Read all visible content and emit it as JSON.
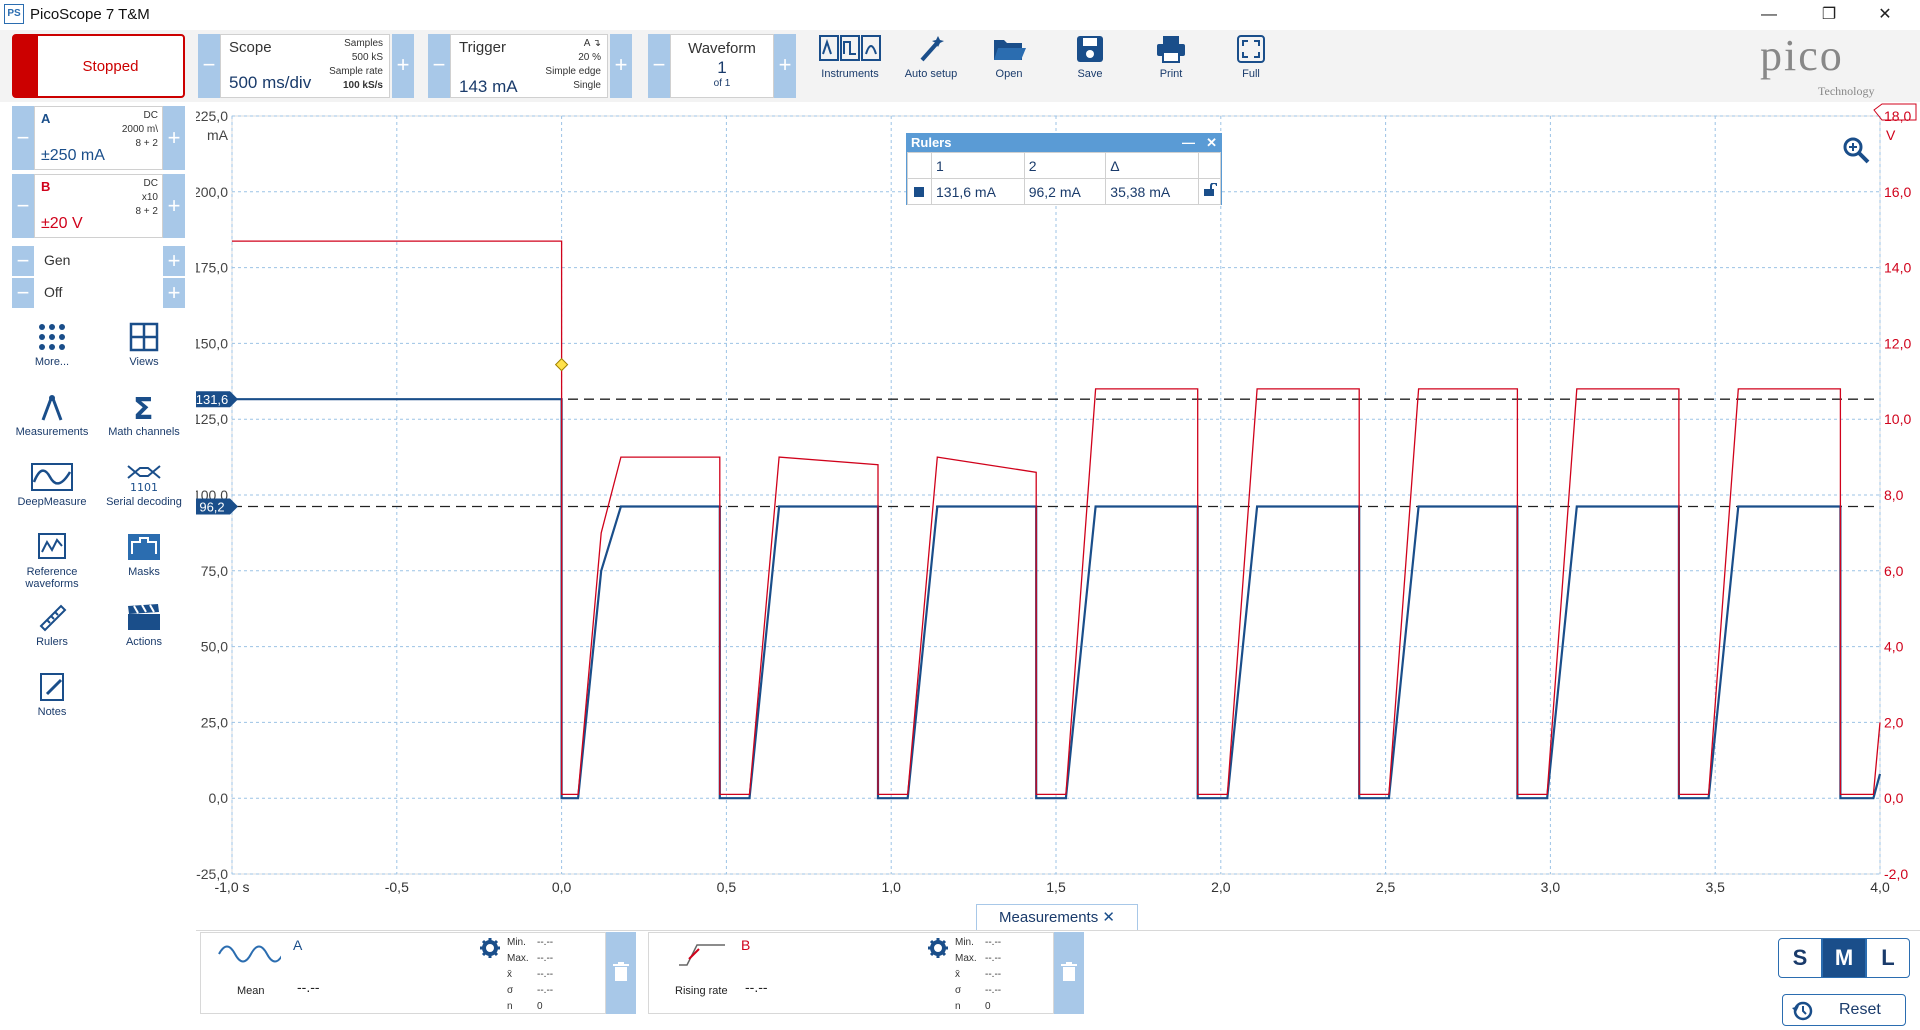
{
  "app": {
    "title": "PicoScope 7 T&M",
    "logo": "PS"
  },
  "window": {
    "minimize": "—",
    "maximize": "❐",
    "close": "✕"
  },
  "toolbar": {
    "run_state": "Stopped",
    "scope": {
      "label": "Scope",
      "value": "500 ms/div",
      "samples_label": "Samples",
      "samples": "500 kS",
      "rate_label": "Sample rate",
      "rate": "100 kS/s"
    },
    "trigger": {
      "label": "Trigger",
      "value": "143 mA",
      "channel": "A",
      "pct": "20 %",
      "type": "Simple edge",
      "mode": "Single"
    },
    "waveform": {
      "label": "Waveform",
      "value": "1",
      "of": "of 1"
    },
    "tools": [
      {
        "label": "Instruments"
      },
      {
        "label": "Auto setup"
      },
      {
        "label": "Open"
      },
      {
        "label": "Save"
      },
      {
        "label": "Print"
      },
      {
        "label": "Full"
      }
    ],
    "brand": "pico",
    "brand_sub": "Technology"
  },
  "channels": [
    {
      "name": "A",
      "range": "±250 mA",
      "coupling": "DC",
      "probe": "2000 m\\",
      "bits": "8 + 2",
      "color": "#1a4e8a"
    },
    {
      "name": "B",
      "range": "±20 V",
      "coupling": "DC",
      "probe": "x10",
      "bits": "8 + 2",
      "color": "#d0021b"
    }
  ],
  "gen": {
    "label": "Gen",
    "state": "Off"
  },
  "side_tools": [
    {
      "label": "More..."
    },
    {
      "label": "Views"
    },
    {
      "label": "Measurements"
    },
    {
      "label": "Math channels"
    },
    {
      "label": "DeepMeasure"
    },
    {
      "label": "Serial decoding"
    },
    {
      "label": "Reference waveforms"
    },
    {
      "label": "Masks"
    },
    {
      "label": "Rulers"
    },
    {
      "label": "Actions"
    },
    {
      "label": "Notes"
    }
  ],
  "plot": {
    "left_unit": "mA",
    "right_unit": "V",
    "left_ticks": [
      "225,0",
      "200,0",
      "175,0",
      "150,0",
      "125,0",
      "100,0",
      "75,0",
      "50,0",
      "25,0",
      "0,0",
      "-25,0"
    ],
    "right_ticks": [
      "18,0",
      "16,0",
      "14,0",
      "12,0",
      "10,0",
      "8,0",
      "6,0",
      "4,0",
      "2,0",
      "0,0",
      "-2,0"
    ],
    "x_ticks": [
      "-1,0 s",
      "-0,5",
      "0,0",
      "0,5",
      "1,0",
      "1,5",
      "2,0",
      "2,5",
      "3,0",
      "3,5",
      "4,0"
    ],
    "ruler1": "131,6",
    "ruler2": "96,2"
  },
  "chart_data": {
    "type": "line",
    "xlabel": "s",
    "ylabel": "mA",
    "xlim": [
      -1.0,
      4.0
    ],
    "ylim": [
      -25,
      225
    ],
    "y2lim": [
      -2,
      18
    ],
    "series": [
      {
        "name": "A",
        "color": "#1a4e8a",
        "axis": "left",
        "x": [
          -1.0,
          0.0,
          0.0,
          0.05,
          0.12,
          0.18,
          0.48,
          0.48,
          0.57,
          0.66,
          0.96,
          0.96,
          1.05,
          1.14,
          1.44,
          1.44,
          1.53,
          1.62,
          1.93,
          1.93,
          2.02,
          2.11,
          2.42,
          2.42,
          2.51,
          2.6,
          2.9,
          2.9,
          2.99,
          3.08,
          3.39,
          3.39,
          3.48,
          3.57,
          3.88,
          3.88,
          3.98,
          4.0
        ],
        "values": [
          131.6,
          131.6,
          0,
          0,
          75,
          96.2,
          96.2,
          0,
          0,
          96.2,
          96.2,
          0,
          0,
          96.2,
          96.2,
          0,
          0,
          96.2,
          96.2,
          0,
          0,
          96.2,
          96.2,
          0,
          0,
          96.2,
          96.2,
          0,
          0,
          96.2,
          96.2,
          0,
          0,
          96.2,
          96.2,
          0,
          0,
          8
        ]
      },
      {
        "name": "B",
        "color": "#d0021b",
        "axis": "right",
        "x": [
          -1.0,
          0.0,
          0.0,
          0.05,
          0.12,
          0.18,
          0.48,
          0.48,
          0.57,
          0.66,
          0.96,
          0.96,
          1.05,
          1.14,
          1.44,
          1.44,
          1.53,
          1.62,
          1.93,
          1.93,
          2.02,
          2.11,
          2.42,
          2.42,
          2.51,
          2.6,
          2.9,
          2.9,
          2.99,
          3.08,
          3.39,
          3.39,
          3.48,
          3.57,
          3.88,
          3.88,
          3.98,
          4.0
        ],
        "values": [
          14.7,
          14.7,
          0.1,
          0.1,
          7,
          9.0,
          9.0,
          0.1,
          0.1,
          9.0,
          8.8,
          0.1,
          0.1,
          9.0,
          8.6,
          0.1,
          0.1,
          10.8,
          10.8,
          0.1,
          0.1,
          10.8,
          10.8,
          0.1,
          0.1,
          10.8,
          10.8,
          0.1,
          0.1,
          10.8,
          10.8,
          0.1,
          0.1,
          10.8,
          10.8,
          0.1,
          0.1,
          2.0
        ]
      }
    ],
    "rulers": [
      131.6,
      96.2
    ],
    "grid": true
  },
  "rulers_panel": {
    "title": "Rulers",
    "col1": "1",
    "col2": "2",
    "col3": "Δ",
    "v1": "131,6 mA",
    "v2": "96,2 mA",
    "delta": "35,38 mA"
  },
  "measurements": {
    "tab": "Measurements",
    "items": [
      {
        "channel": "A",
        "name": "Mean",
        "value": "--.--",
        "min": "--.--",
        "max": "--.--",
        "mean": "--.--",
        "sigma": "--.--",
        "n": "0"
      },
      {
        "channel": "B",
        "name": "Rising rate",
        "value": "--.--",
        "min": "--.--",
        "max": "--.--",
        "mean": "--.--",
        "sigma": "--.--",
        "n": "0"
      }
    ],
    "stat_labels": {
      "min": "Min.",
      "max": "Max.",
      "mean": "x̄",
      "sigma": "σ",
      "n": "n"
    }
  },
  "size_buttons": [
    "S",
    "M",
    "L"
  ],
  "reset": "Reset"
}
